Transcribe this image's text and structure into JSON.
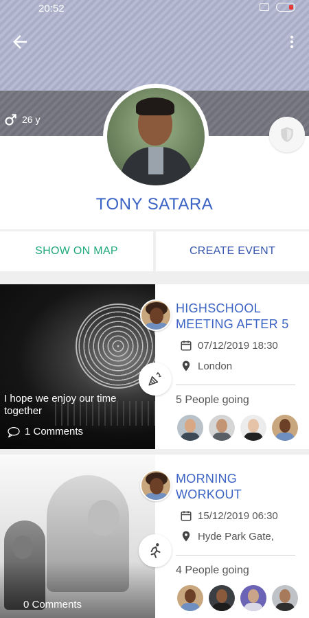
{
  "status_bar": {
    "time": "20:52",
    "battery": "16"
  },
  "profile": {
    "name": "TONY SATARA",
    "age": "26 y",
    "gender_icon": "male-icon"
  },
  "actions": {
    "show_on_map": "SHOW ON MAP",
    "create_event": "CREATE EVENT"
  },
  "events": [
    {
      "title": "HIGHSCHOOL MEETING AFTER 5",
      "date": "07/12/2019 18:30",
      "location": "London",
      "going": "5 People going",
      "caption": "I hope we enjoy our time together",
      "comments": "1 Comments",
      "category_icon": "party-popper-icon"
    },
    {
      "title": "MORNING WORKOUT",
      "date": "15/12/2019 06:30",
      "location": "Hyde Park Gate,",
      "going": "4 People going",
      "caption": "",
      "comments": "0 Comments",
      "category_icon": "running-icon"
    }
  ],
  "colors": {
    "accent_blue": "#3b63c4",
    "map_green": "#1fa87a",
    "event_blue": "#3655ab"
  }
}
